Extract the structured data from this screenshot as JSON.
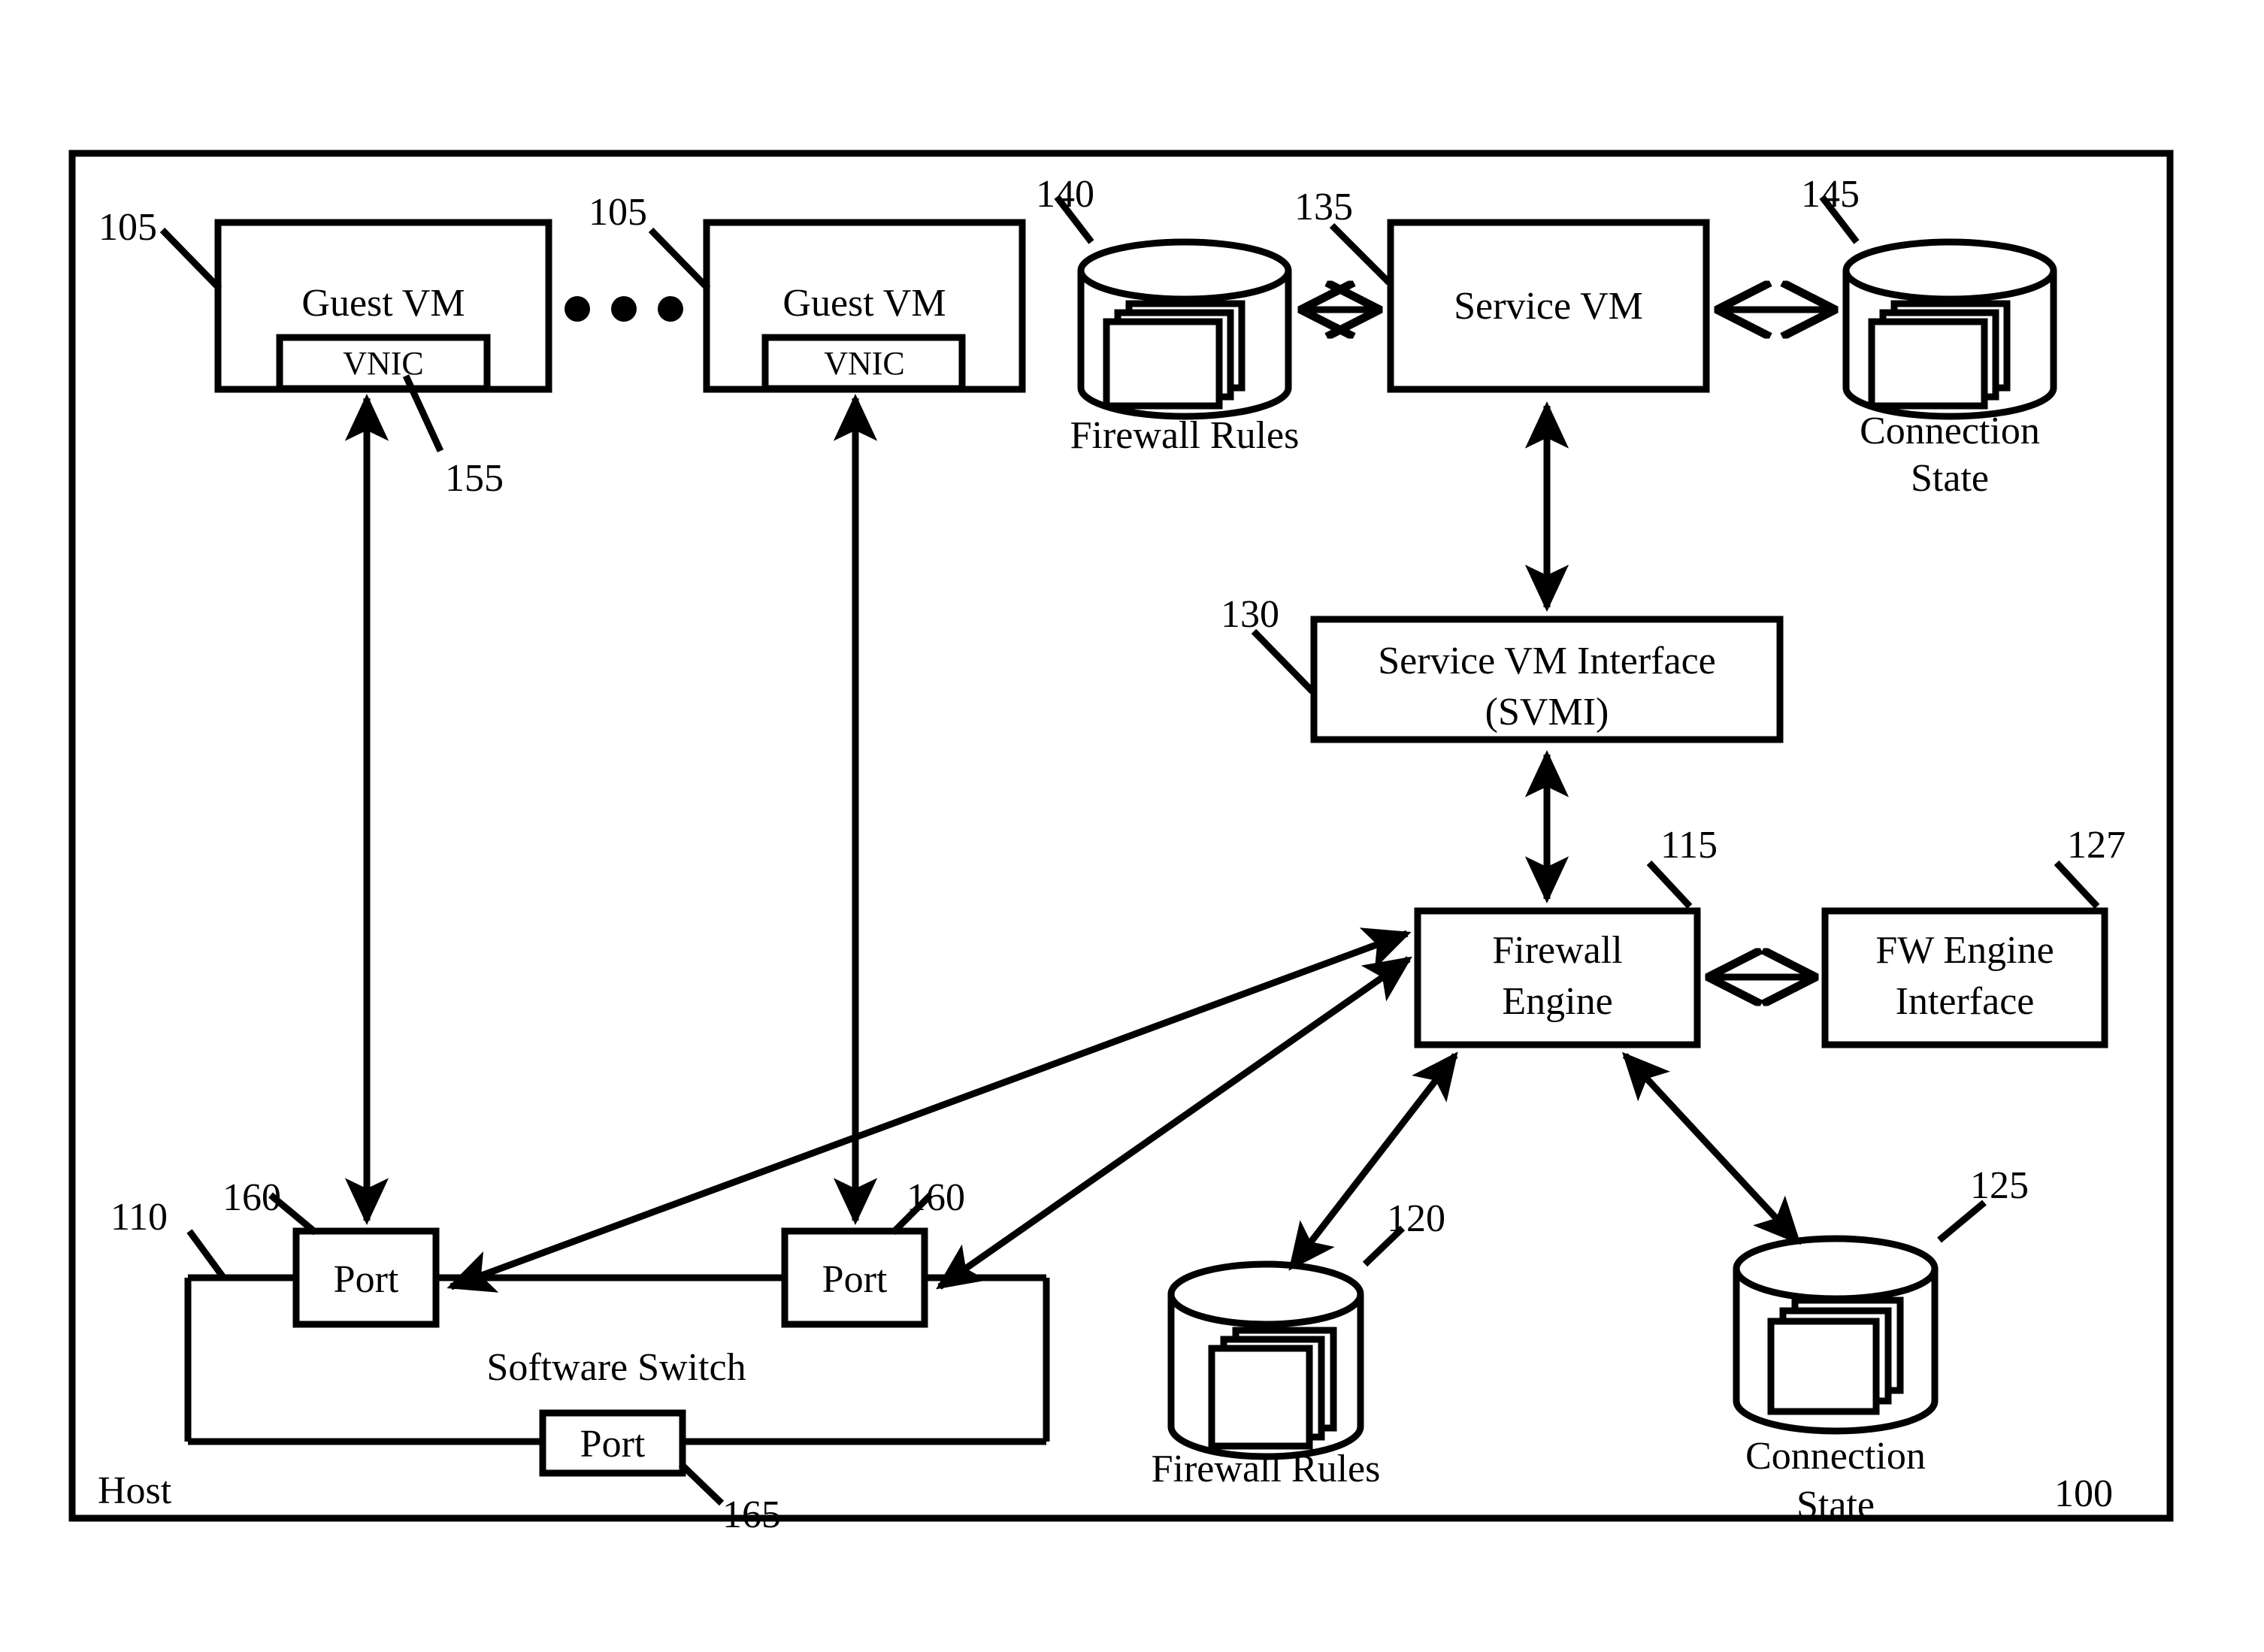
{
  "figure": {
    "outer_box_label": "Host",
    "figure_ref": "100"
  },
  "nodes": {
    "guest_vm_left": {
      "label": "Guest VM",
      "ref": "105",
      "vnic_label": "VNIC",
      "vnic_ref": "155"
    },
    "guest_vm_right": {
      "label": "Guest VM",
      "ref": "105",
      "vnic_label": "VNIC"
    },
    "ellipsis": "• • •",
    "firewall_rules_top": {
      "label": "Firewall Rules",
      "ref": "140"
    },
    "service_vm": {
      "label": "Service VM",
      "ref": "135"
    },
    "connection_state_top": {
      "label_line1": "Connection",
      "label_line2": "State",
      "ref": "145"
    },
    "svmi": {
      "label_line1": "Service VM Interface",
      "label_line2": "(SVMI)",
      "ref": "130"
    },
    "firewall_engine": {
      "label_line1": "Firewall",
      "label_line2": "Engine",
      "ref": "115"
    },
    "fw_engine_interface": {
      "label_line1": "FW Engine",
      "label_line2": "Interface",
      "ref": "127"
    },
    "firewall_rules_bottom": {
      "label": "Firewall Rules",
      "ref": "120"
    },
    "connection_state_bottom": {
      "label_line1": "Connection",
      "label_line2": "State",
      "ref": "125"
    },
    "software_switch": {
      "label": "Software Switch",
      "ref": "110"
    },
    "port_left": {
      "label": "Port",
      "ref": "160"
    },
    "port_right": {
      "label": "Port",
      "ref": "160"
    },
    "port_bottom": {
      "label": "Port",
      "ref": "165"
    }
  },
  "colors": {
    "stroke": "#000000",
    "background": "#ffffff"
  }
}
